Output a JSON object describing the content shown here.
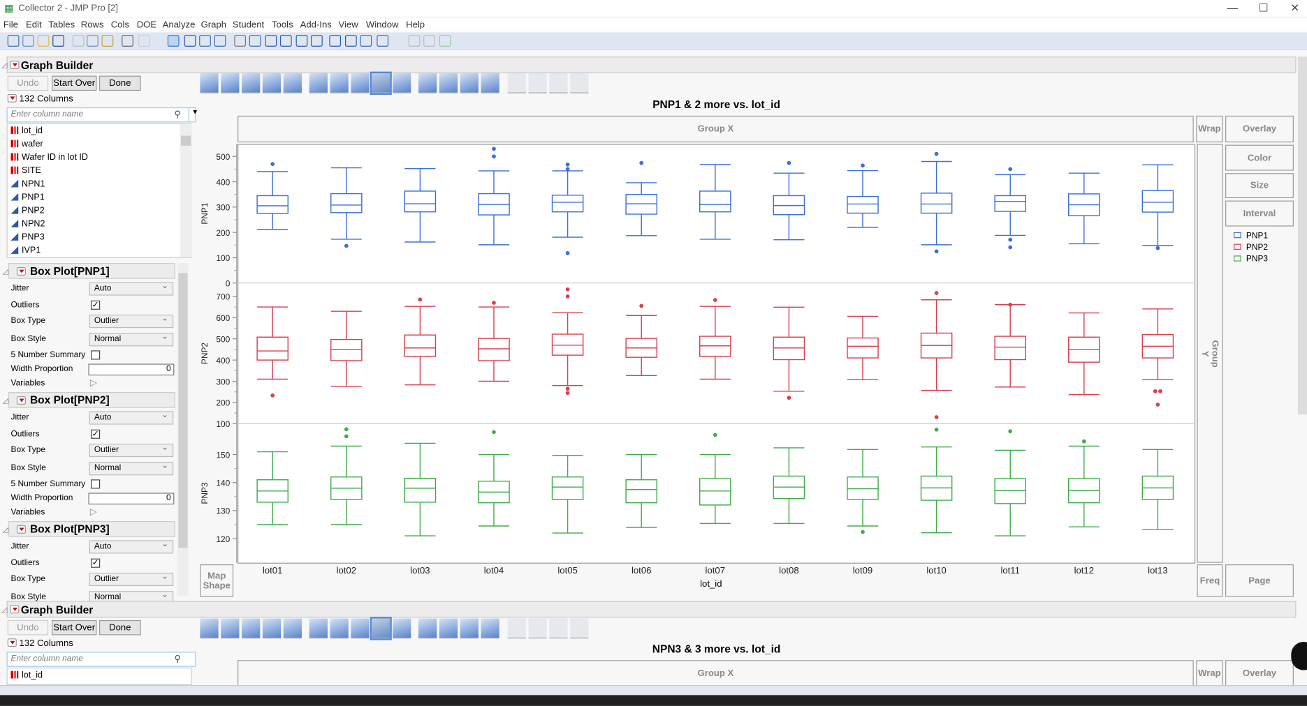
{
  "window": {
    "title": "Collector 2 - JMP Pro [2]",
    "min": "—",
    "max": "☐",
    "close": "✕"
  },
  "menu": [
    "File",
    "Edit",
    "Tables",
    "Rows",
    "Cols",
    "DOE",
    "Analyze",
    "Graph",
    "Student",
    "Tools",
    "Add-Ins",
    "View",
    "Window",
    "Help"
  ],
  "builder1": {
    "title": "Graph Builder",
    "undo": "Undo",
    "start_over": "Start Over",
    "done": "Done",
    "columns_count": "132 Columns",
    "search_placeholder": "Enter column name",
    "columns": [
      {
        "name": "lot_id",
        "type": "nominal"
      },
      {
        "name": "wafer",
        "type": "nominal"
      },
      {
        "name": "Wafer ID in lot ID",
        "type": "nominal"
      },
      {
        "name": "SITE",
        "type": "nominal"
      },
      {
        "name": "NPN1",
        "type": "continuous"
      },
      {
        "name": "PNP1",
        "type": "continuous"
      },
      {
        "name": "PNP2",
        "type": "continuous"
      },
      {
        "name": "NPN2",
        "type": "continuous"
      },
      {
        "name": "PNP3",
        "type": "continuous"
      },
      {
        "name": "IVP1",
        "type": "continuous"
      }
    ],
    "boxplots": [
      {
        "title": "Box Plot[PNP1]",
        "jitter_label": "Jitter",
        "jitter": "Auto",
        "outliers_label": "Outliers",
        "outliers": "✓",
        "boxtype_label": "Box Type",
        "boxtype": "Outlier",
        "boxstyle_label": "Box Style",
        "boxstyle": "Normal",
        "fivenum_label": "5 Number Summary",
        "width_label": "Width Proportion",
        "width": "0",
        "variables_label": "Variables"
      },
      {
        "title": "Box Plot[PNP2]",
        "jitter_label": "Jitter",
        "jitter": "Auto",
        "outliers_label": "Outliers",
        "outliers": "✓",
        "boxtype_label": "Box Type",
        "boxtype": "Outlier",
        "boxstyle_label": "Box Style",
        "boxstyle": "Normal",
        "fivenum_label": "5 Number Summary",
        "width_label": "Width Proportion",
        "width": "0",
        "variables_label": "Variables"
      },
      {
        "title": "Box Plot[PNP3]",
        "jitter_label": "Jitter",
        "jitter": "Auto",
        "outliers_label": "Outliers",
        "outliers": "✓",
        "boxtype_label": "Box Type",
        "boxtype": "Outlier",
        "boxstyle_label": "Box Style",
        "boxstyle": "Normal"
      }
    ],
    "zones": {
      "group_x": "Group X",
      "group_y": "Group Y",
      "wrap": "Wrap",
      "overlay": "Overlay",
      "color": "Color",
      "size": "Size",
      "interval": "Interval",
      "map_shape": "Map\nShape",
      "freq": "Freq",
      "page": "Page"
    }
  },
  "builder2": {
    "title": "Graph Builder",
    "undo": "Undo",
    "start_over": "Start Over",
    "done": "Done",
    "columns_count": "132 Columns",
    "search_placeholder": "Enter column name",
    "first_column": "lot_id",
    "graph_title": "NPN3 & 3 more vs. lot_id",
    "group_x": "Group X",
    "wrap": "Wrap",
    "overlay": "Overlay"
  },
  "chart_data": {
    "type": "box",
    "title": "PNP1 & 2 more vs. lot_id",
    "xlabel": "lot_id",
    "categories": [
      "lot01",
      "lot02",
      "lot03",
      "lot04",
      "lot05",
      "lot06",
      "lot07",
      "lot08",
      "lot09",
      "lot10",
      "lot11",
      "lot12",
      "lot13"
    ],
    "legend": [
      "PNP1",
      "PNP2",
      "PNP3"
    ],
    "legend_placement": "right",
    "series": [
      {
        "name": "PNP1",
        "color": "#3a6fdc",
        "ylim": [
          0,
          549
        ],
        "ticks": [
          0,
          100,
          200,
          300,
          400,
          500
        ],
        "boxes": [
          [
            212,
            275,
            305,
            345,
            440
          ],
          [
            173,
            278,
            308,
            353,
            455
          ],
          [
            162,
            281,
            313,
            363,
            452
          ],
          [
            151,
            269,
            310,
            353,
            443
          ],
          [
            181,
            281,
            319,
            347,
            443
          ],
          [
            187,
            272,
            313,
            350,
            396
          ],
          [
            173,
            281,
            310,
            363,
            468
          ],
          [
            171,
            270,
            306,
            345,
            434
          ],
          [
            220,
            276,
            312,
            342,
            444
          ],
          [
            151,
            276,
            312,
            355,
            480
          ],
          [
            188,
            283,
            322,
            345,
            428
          ],
          [
            155,
            266,
            309,
            352,
            434
          ],
          [
            148,
            280,
            319,
            365,
            467
          ]
        ],
        "outliers": [
          [
            470
          ],
          [
            147
          ],
          [],
          [
            500,
            530
          ],
          [
            450,
            468,
            118
          ],
          [
            474
          ],
          [],
          [
            474
          ],
          [
            464
          ],
          [
            510,
            125
          ],
          [
            450,
            171,
            141
          ],
          [],
          [
            138
          ]
        ]
      },
      {
        "name": "PNP2",
        "color": "#d9404f",
        "ylim": [
          100,
          763
        ],
        "ticks": [
          100,
          200,
          300,
          400,
          500,
          600,
          700
        ],
        "boxes": [
          [
            310,
            400,
            443,
            508,
            650
          ],
          [
            276,
            397,
            450,
            497,
            630
          ],
          [
            283,
            417,
            457,
            518,
            653
          ],
          [
            300,
            397,
            453,
            502,
            650
          ],
          [
            280,
            423,
            470,
            522,
            623
          ],
          [
            327,
            413,
            457,
            502,
            610
          ],
          [
            310,
            417,
            467,
            512,
            653
          ],
          [
            253,
            402,
            457,
            508,
            649
          ],
          [
            308,
            410,
            465,
            504,
            606
          ],
          [
            257,
            410,
            469,
            527,
            684
          ],
          [
            273,
            402,
            461,
            512,
            661
          ],
          [
            237,
            390,
            449,
            508,
            622
          ],
          [
            308,
            410,
            465,
            520,
            641
          ]
        ],
        "outliers": [
          [
            233
          ],
          [],
          [
            685
          ],
          [
            670
          ],
          [
            245,
            265,
            700,
            733
          ],
          [
            655
          ],
          [
            683
          ],
          [
            222
          ],
          [],
          [
            716,
            131
          ],
          [
            661
          ],
          [],
          [
            253,
            253,
            190
          ]
        ]
      },
      {
        "name": "PNP3",
        "color": "#3fae4a",
        "ylim": [
          111.4,
          161
        ],
        "ticks": [
          120,
          130,
          140,
          150
        ],
        "boxes": [
          [
            125,
            133,
            137,
            141,
            151
          ],
          [
            125,
            134,
            138,
            142,
            153
          ],
          [
            121,
            133,
            138,
            141.5,
            154
          ],
          [
            124.5,
            132.8,
            136.6,
            140.5,
            150
          ],
          [
            122,
            134,
            138.4,
            142,
            149.7
          ],
          [
            124,
            132.8,
            137.5,
            141,
            150
          ],
          [
            125.4,
            132,
            137,
            141.4,
            150
          ],
          [
            125.4,
            134.3,
            138.4,
            142.3,
            152.4
          ],
          [
            124.5,
            134,
            137.8,
            142,
            151.8
          ],
          [
            122.1,
            133.7,
            138.1,
            142.3,
            152.7
          ],
          [
            121,
            132.5,
            137.2,
            141.4,
            151.5
          ],
          [
            124.2,
            132.8,
            137.2,
            141.4,
            153
          ],
          [
            123.3,
            134,
            138.1,
            142.3,
            151.8
          ]
        ],
        "outliers": [
          [],
          [
            159,
            156.5
          ],
          [],
          [
            158
          ],
          [],
          [],
          [
            157
          ],
          [],
          [
            122.4
          ],
          [
            158.9
          ],
          [
            158.3
          ],
          [
            154.7
          ],
          []
        ]
      }
    ]
  }
}
